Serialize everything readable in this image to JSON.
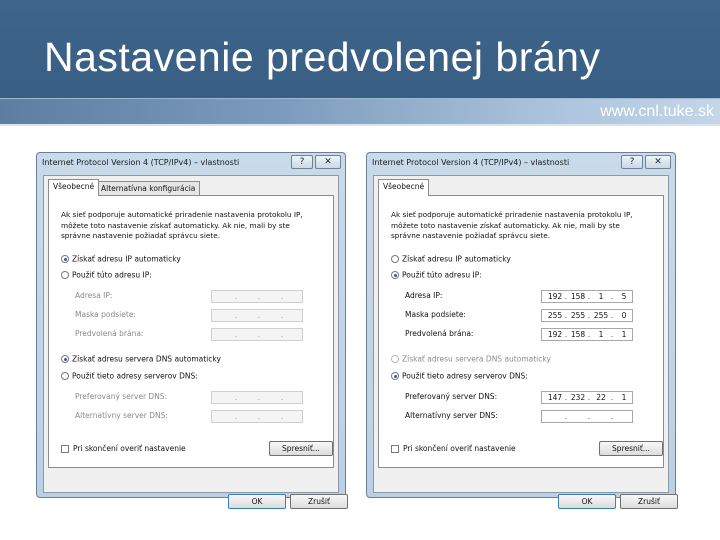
{
  "slide": {
    "title": "Nastavenie predvolenej brány",
    "url": "www.cnl.tuke.sk"
  },
  "dialogs": [
    {
      "title": "Internet Protocol Version 4 (TCP/IPv4) – vlastnosti",
      "help_label": "?",
      "close_label": "✕",
      "tabs": [
        "Všeobecné",
        "Alternatívna konfigurácia"
      ],
      "description": "Ak sieť podporuje automatické priradenie nastavenia protokolu IP, môžete toto nastavenie získať automaticky. Ak nie, mali by ste správne nastavenie požiadať správcu siete.",
      "ip_auto_label": "Získať adresu IP automaticky",
      "ip_manual_label": "Použiť túto adresu IP:",
      "ip_mode": "auto",
      "fields": [
        {
          "label": "Adresa IP:",
          "octets": [
            "",
            "",
            "",
            ""
          ]
        },
        {
          "label": "Maska podsiete:",
          "octets": [
            "",
            "",
            "",
            ""
          ]
        },
        {
          "label": "Predvolená brána:",
          "octets": [
            "",
            "",
            "",
            ""
          ]
        }
      ],
      "dns_auto_label": "Získať adresu servera DNS automaticky",
      "dns_manual_label": "Použiť tieto adresy serverov DNS:",
      "dns_mode": "auto",
      "dns_fields": [
        {
          "label": "Preferovaný server DNS:",
          "octets": [
            "",
            "",
            "",
            ""
          ]
        },
        {
          "label": "Alternatívny server DNS:",
          "octets": [
            "",
            "",
            "",
            ""
          ]
        }
      ],
      "validate_label": "Pri skončení overiť nastavenie",
      "advanced_label": "Spresniť...",
      "ok_label": "OK",
      "cancel_label": "Zrušiť"
    },
    {
      "title": "Internet Protocol Version 4 (TCP/IPv4) – vlastnosti",
      "help_label": "?",
      "close_label": "✕",
      "tabs": [
        "Všeobecné"
      ],
      "description": "Ak sieť podporuje automatické priradenie nastavenia protokolu IP, môžete toto nastavenie získať automaticky. Ak nie, mali by ste správne nastavenie požiadať správcu siete.",
      "ip_auto_label": "Získať adresu IP automaticky",
      "ip_manual_label": "Použiť túto adresu IP:",
      "ip_mode": "manual",
      "fields": [
        {
          "label": "Adresa IP:",
          "octets": [
            "192",
            "158",
            "1",
            "5"
          ]
        },
        {
          "label": "Maska podsiete:",
          "octets": [
            "255",
            "255",
            "255",
            "0"
          ]
        },
        {
          "label": "Predvolená brána:",
          "octets": [
            "192",
            "158",
            "1",
            "1"
          ]
        }
      ],
      "dns_auto_label": "Získať adresu servera DNS automaticky",
      "dns_manual_label": "Použiť tieto adresy serverov DNS:",
      "dns_mode": "manual",
      "dns_fields": [
        {
          "label": "Preferovaný server DNS:",
          "octets": [
            "147",
            "232",
            "22",
            "1"
          ]
        },
        {
          "label": "Alternatívny server DNS:",
          "octets": [
            "",
            "",
            "",
            ""
          ]
        }
      ],
      "validate_label": "Pri skončení overiť nastavenie",
      "advanced_label": "Spresniť...",
      "ok_label": "OK",
      "cancel_label": "Zrušiť"
    }
  ]
}
